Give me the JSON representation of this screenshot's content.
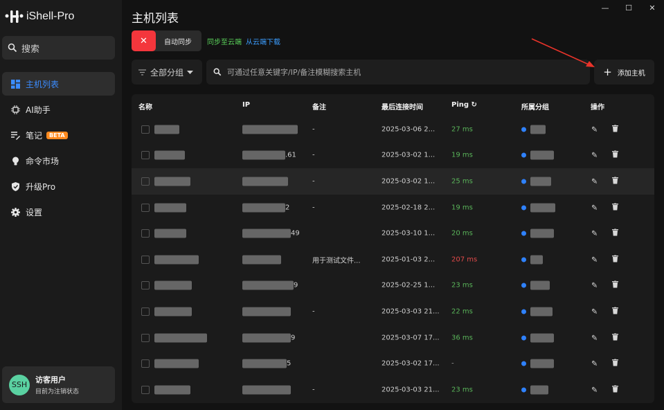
{
  "app": {
    "name": "iShell-Pro"
  },
  "sidebar": {
    "search_label": "搜索",
    "items": [
      {
        "label": "主机列表",
        "icon": "dashboard-icon",
        "active": true
      },
      {
        "label": "AI助手",
        "icon": "chip-icon",
        "active": false
      },
      {
        "label": "笔记",
        "icon": "notes-icon",
        "active": false,
        "badge": "BETA"
      },
      {
        "label": "命令市场",
        "icon": "bulb-icon",
        "active": false
      },
      {
        "label": "升级Pro",
        "icon": "shield-icon",
        "active": false
      },
      {
        "label": "设置",
        "icon": "gear-icon",
        "active": false
      }
    ],
    "user": {
      "avatar": "SSH",
      "name": "访客用户",
      "status": "目前为注销状态"
    }
  },
  "window": {
    "minimize": "—",
    "maximize": "☐",
    "close": "✕"
  },
  "main": {
    "title": "主机列表",
    "sync": {
      "close_label": "✕",
      "auto_label": "自动同步",
      "upload_label": "同步至云端",
      "download_label": "从云端下载"
    },
    "filter": {
      "group_label": "全部分组",
      "search_placeholder": "可通过任意关键字/IP/备注模糊搜索主机",
      "add_label": "添加主机"
    },
    "table": {
      "headers": {
        "name": "名称",
        "ip": "IP",
        "note": "备注",
        "last": "最后连接时间",
        "ping": "Ping",
        "group": "所属分组",
        "ops": "操作"
      },
      "rows": [
        {
          "ip_suffix": "",
          "note": "-",
          "last": "2025-03-06 2...",
          "ping": "27 ms",
          "ping_status": "good"
        },
        {
          "ip_suffix": ".61",
          "note": "-",
          "last": "2025-03-02 1...",
          "ping": "19 ms",
          "ping_status": "good"
        },
        {
          "ip_suffix": "",
          "note": "-",
          "last": "2025-03-02 1...",
          "ping": "25 ms",
          "ping_status": "good",
          "highlight": true
        },
        {
          "ip_suffix": "2",
          "note": "-",
          "last": "2025-02-18 2...",
          "ping": "19 ms",
          "ping_status": "good"
        },
        {
          "ip_suffix": "49",
          "note": "",
          "last": "2025-03-10 1...",
          "ping": "20 ms",
          "ping_status": "good"
        },
        {
          "ip_suffix": "",
          "note": "用于测试文件...",
          "last": "2025-01-03 2...",
          "ping": "207 ms",
          "ping_status": "bad"
        },
        {
          "ip_suffix": "9",
          "note": "",
          "last": "2025-02-25 1...",
          "ping": "23 ms",
          "ping_status": "good"
        },
        {
          "ip_suffix": "",
          "note": "-",
          "last": "2025-03-03 21...",
          "ping": "22 ms",
          "ping_status": "good"
        },
        {
          "ip_suffix": "9",
          "note": "",
          "last": "2025-03-07 17...",
          "ping": "36 ms",
          "ping_status": "good"
        },
        {
          "ip_suffix": "5",
          "note": "",
          "last": "2025-03-02 17...",
          "ping": "-",
          "ping_status": "na"
        },
        {
          "ip_suffix": "",
          "note": "-",
          "last": "2025-03-03 21...",
          "ping": "23 ms",
          "ping_status": "good"
        }
      ]
    }
  },
  "colors": {
    "accent": "#3b8cff",
    "danger": "#f4363c",
    "good": "#5ab55a",
    "bad": "#e24a4a",
    "annotation": "#e8332a"
  }
}
